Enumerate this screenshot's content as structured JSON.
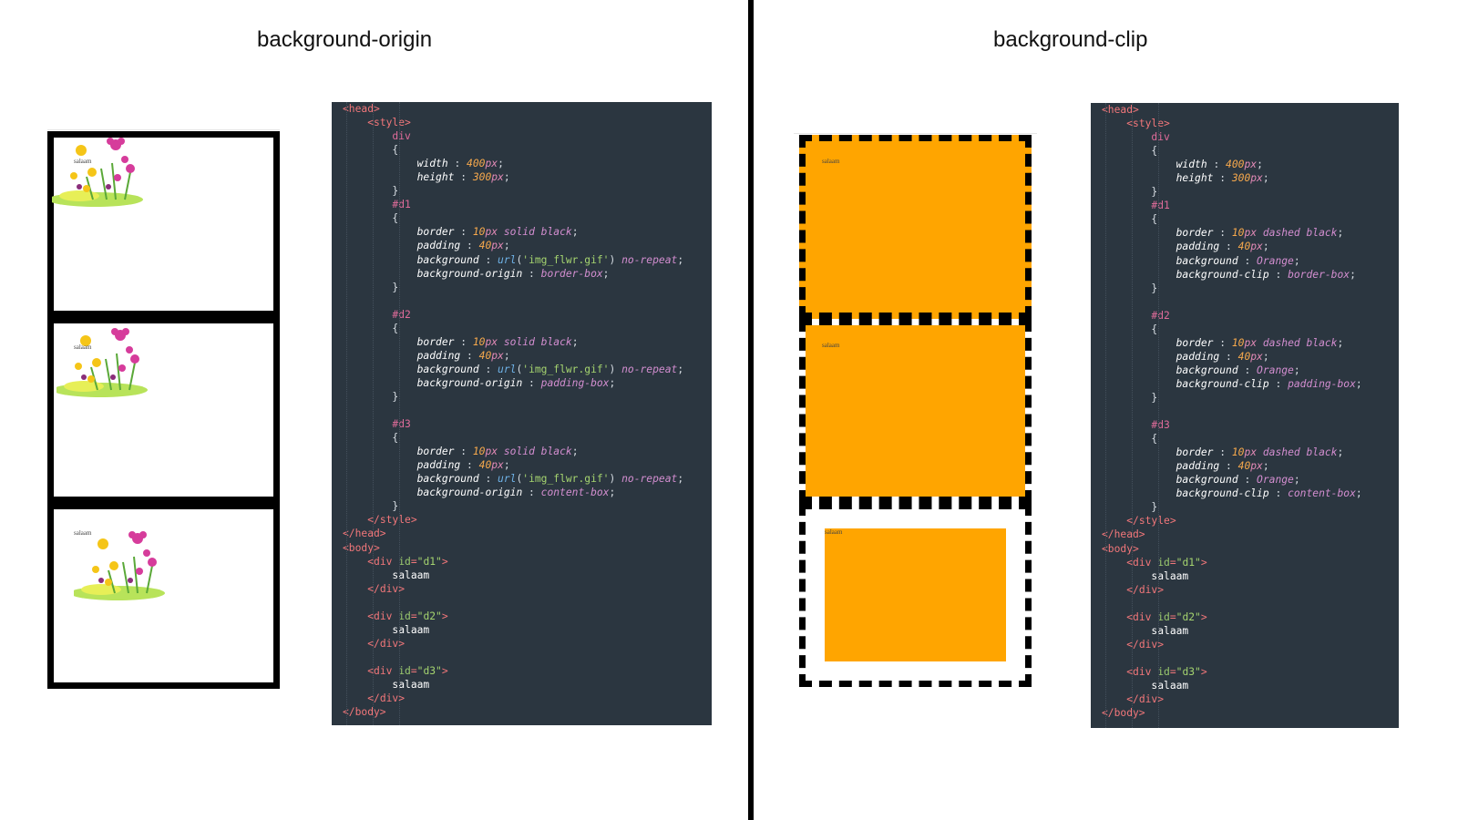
{
  "left_title": "background-origin",
  "right_title": "background-clip",
  "demo_text": "salaam",
  "origin_demo": {
    "boxes": [
      {
        "id": "d1",
        "background_origin": "border-box"
      },
      {
        "id": "d2",
        "background_origin": "padding-box"
      },
      {
        "id": "d3",
        "background_origin": "content-box"
      }
    ]
  },
  "clip_demo": {
    "fill_color": "#ffa500",
    "boxes": [
      {
        "id": "d1",
        "background_clip": "border-box"
      },
      {
        "id": "d2",
        "background_clip": "padding-box"
      },
      {
        "id": "d3",
        "background_clip": "content-box"
      }
    ]
  },
  "origin_code": [
    [
      [
        "tk-tag",
        "<head>"
      ]
    ],
    [
      [
        "tk-p",
        "    "
      ],
      [
        "tk-tag",
        "<style>"
      ]
    ],
    [
      [
        "tk-p",
        "        "
      ],
      [
        "tk-sel",
        "div"
      ]
    ],
    [
      [
        "tk-p",
        "        {"
      ]
    ],
    [
      [
        "tk-p",
        "            "
      ],
      [
        "tk-prop",
        "width"
      ],
      [
        "tk-p",
        " : "
      ],
      [
        "tk-num",
        "400"
      ],
      [
        "tk-unit",
        "px"
      ],
      [
        "tk-p",
        ";"
      ]
    ],
    [
      [
        "tk-p",
        "            "
      ],
      [
        "tk-prop",
        "height"
      ],
      [
        "tk-p",
        " : "
      ],
      [
        "tk-num",
        "300"
      ],
      [
        "tk-unit",
        "px"
      ],
      [
        "tk-p",
        ";"
      ]
    ],
    [
      [
        "tk-p",
        "        }"
      ]
    ],
    [
      [
        "tk-p",
        "        "
      ],
      [
        "tk-sel",
        "#d1"
      ]
    ],
    [
      [
        "tk-p",
        "        {"
      ]
    ],
    [
      [
        "tk-p",
        "            "
      ],
      [
        "tk-prop",
        "border"
      ],
      [
        "tk-p",
        " : "
      ],
      [
        "tk-num",
        "10"
      ],
      [
        "tk-unit",
        "px"
      ],
      [
        "tk-val",
        " solid black"
      ],
      [
        "tk-p",
        ";"
      ]
    ],
    [
      [
        "tk-p",
        "            "
      ],
      [
        "tk-prop",
        "padding"
      ],
      [
        "tk-p",
        " : "
      ],
      [
        "tk-num",
        "40"
      ],
      [
        "tk-unit",
        "px"
      ],
      [
        "tk-p",
        ";"
      ]
    ],
    [
      [
        "tk-p",
        "            "
      ],
      [
        "tk-prop",
        "background"
      ],
      [
        "tk-p",
        " : "
      ],
      [
        "tk-fn",
        "url"
      ],
      [
        "tk-p",
        "("
      ],
      [
        "tk-str",
        "'img_flwr.gif'"
      ],
      [
        "tk-p",
        ") "
      ],
      [
        "tk-val",
        "no-repeat"
      ],
      [
        "tk-p",
        ";"
      ]
    ],
    [
      [
        "tk-p",
        "            "
      ],
      [
        "tk-prop",
        "background-origin"
      ],
      [
        "tk-p",
        " : "
      ],
      [
        "tk-val",
        "border-box"
      ],
      [
        "tk-p",
        ";"
      ]
    ],
    [
      [
        "tk-p",
        "        }"
      ]
    ],
    [
      [
        "tk-p",
        ""
      ]
    ],
    [
      [
        "tk-p",
        "        "
      ],
      [
        "tk-sel",
        "#d2"
      ]
    ],
    [
      [
        "tk-p",
        "        {"
      ]
    ],
    [
      [
        "tk-p",
        "            "
      ],
      [
        "tk-prop",
        "border"
      ],
      [
        "tk-p",
        " : "
      ],
      [
        "tk-num",
        "10"
      ],
      [
        "tk-unit",
        "px"
      ],
      [
        "tk-val",
        " solid black"
      ],
      [
        "tk-p",
        ";"
      ]
    ],
    [
      [
        "tk-p",
        "            "
      ],
      [
        "tk-prop",
        "padding"
      ],
      [
        "tk-p",
        " : "
      ],
      [
        "tk-num",
        "40"
      ],
      [
        "tk-unit",
        "px"
      ],
      [
        "tk-p",
        ";"
      ]
    ],
    [
      [
        "tk-p",
        "            "
      ],
      [
        "tk-prop",
        "background"
      ],
      [
        "tk-p",
        " : "
      ],
      [
        "tk-fn",
        "url"
      ],
      [
        "tk-p",
        "("
      ],
      [
        "tk-str",
        "'img_flwr.gif'"
      ],
      [
        "tk-p",
        ") "
      ],
      [
        "tk-val",
        "no-repeat"
      ],
      [
        "tk-p",
        ";"
      ]
    ],
    [
      [
        "tk-p",
        "            "
      ],
      [
        "tk-prop",
        "background-origin"
      ],
      [
        "tk-p",
        " : "
      ],
      [
        "tk-val",
        "padding-box"
      ],
      [
        "tk-p",
        ";"
      ]
    ],
    [
      [
        "tk-p",
        "        }"
      ]
    ],
    [
      [
        "tk-p",
        ""
      ]
    ],
    [
      [
        "tk-p",
        "        "
      ],
      [
        "tk-sel",
        "#d3"
      ]
    ],
    [
      [
        "tk-p",
        "        {"
      ]
    ],
    [
      [
        "tk-p",
        "            "
      ],
      [
        "tk-prop",
        "border"
      ],
      [
        "tk-p",
        " : "
      ],
      [
        "tk-num",
        "10"
      ],
      [
        "tk-unit",
        "px"
      ],
      [
        "tk-val",
        " solid black"
      ],
      [
        "tk-p",
        ";"
      ]
    ],
    [
      [
        "tk-p",
        "            "
      ],
      [
        "tk-prop",
        "padding"
      ],
      [
        "tk-p",
        " : "
      ],
      [
        "tk-num",
        "40"
      ],
      [
        "tk-unit",
        "px"
      ],
      [
        "tk-p",
        ";"
      ]
    ],
    [
      [
        "tk-p",
        "            "
      ],
      [
        "tk-prop",
        "background"
      ],
      [
        "tk-p",
        " : "
      ],
      [
        "tk-fn",
        "url"
      ],
      [
        "tk-p",
        "("
      ],
      [
        "tk-str",
        "'img_flwr.gif'"
      ],
      [
        "tk-p",
        ") "
      ],
      [
        "tk-val",
        "no-repeat"
      ],
      [
        "tk-p",
        ";"
      ]
    ],
    [
      [
        "tk-p",
        "            "
      ],
      [
        "tk-prop",
        "background-origin"
      ],
      [
        "tk-p",
        " : "
      ],
      [
        "tk-val",
        "content-box"
      ],
      [
        "tk-p",
        ";"
      ]
    ],
    [
      [
        "tk-p",
        "        }"
      ]
    ],
    [
      [
        "tk-p",
        "    "
      ],
      [
        "tk-tag",
        "</style>"
      ]
    ],
    [
      [
        "tk-tag",
        "</head>"
      ]
    ],
    [
      [
        "tk-tag",
        "<body>"
      ]
    ],
    [
      [
        "tk-p",
        "    "
      ],
      [
        "tk-tag",
        "<div "
      ],
      [
        "tk-attr",
        "id"
      ],
      [
        "tk-tag",
        "="
      ],
      [
        "tk-str",
        "\"d1\""
      ],
      [
        "tk-tag",
        ">"
      ]
    ],
    [
      [
        "tk-txt",
        "        salaam"
      ]
    ],
    [
      [
        "tk-p",
        "    "
      ],
      [
        "tk-tag",
        "</div>"
      ]
    ],
    [
      [
        "tk-p",
        ""
      ]
    ],
    [
      [
        "tk-p",
        "    "
      ],
      [
        "tk-tag",
        "<div "
      ],
      [
        "tk-attr",
        "id"
      ],
      [
        "tk-tag",
        "="
      ],
      [
        "tk-str",
        "\"d2\""
      ],
      [
        "tk-tag",
        ">"
      ]
    ],
    [
      [
        "tk-txt",
        "        salaam"
      ]
    ],
    [
      [
        "tk-p",
        "    "
      ],
      [
        "tk-tag",
        "</div>"
      ]
    ],
    [
      [
        "tk-p",
        ""
      ]
    ],
    [
      [
        "tk-p",
        "    "
      ],
      [
        "tk-tag",
        "<div "
      ],
      [
        "tk-attr",
        "id"
      ],
      [
        "tk-tag",
        "="
      ],
      [
        "tk-str",
        "\"d3\""
      ],
      [
        "tk-tag",
        ">"
      ]
    ],
    [
      [
        "tk-txt",
        "        salaam"
      ]
    ],
    [
      [
        "tk-p",
        "    "
      ],
      [
        "tk-tag",
        "</div>"
      ]
    ],
    [
      [
        "tk-tag",
        "</body>"
      ]
    ]
  ],
  "clip_code": [
    [
      [
        "tk-tag",
        "<head>"
      ]
    ],
    [
      [
        "tk-p",
        "    "
      ],
      [
        "tk-tag",
        "<style>"
      ]
    ],
    [
      [
        "tk-p",
        "        "
      ],
      [
        "tk-sel",
        "div"
      ]
    ],
    [
      [
        "tk-p",
        "        {"
      ]
    ],
    [
      [
        "tk-p",
        "            "
      ],
      [
        "tk-prop",
        "width"
      ],
      [
        "tk-p",
        " : "
      ],
      [
        "tk-num",
        "400"
      ],
      [
        "tk-unit",
        "px"
      ],
      [
        "tk-p",
        ";"
      ]
    ],
    [
      [
        "tk-p",
        "            "
      ],
      [
        "tk-prop",
        "height"
      ],
      [
        "tk-p",
        " : "
      ],
      [
        "tk-num",
        "300"
      ],
      [
        "tk-unit",
        "px"
      ],
      [
        "tk-p",
        ";"
      ]
    ],
    [
      [
        "tk-p",
        "        }"
      ]
    ],
    [
      [
        "tk-p",
        "        "
      ],
      [
        "tk-sel",
        "#d1"
      ]
    ],
    [
      [
        "tk-p",
        "        {"
      ]
    ],
    [
      [
        "tk-p",
        "            "
      ],
      [
        "tk-prop",
        "border"
      ],
      [
        "tk-p",
        " : "
      ],
      [
        "tk-num",
        "10"
      ],
      [
        "tk-unit",
        "px"
      ],
      [
        "tk-val",
        " dashed black"
      ],
      [
        "tk-p",
        ";"
      ]
    ],
    [
      [
        "tk-p",
        "            "
      ],
      [
        "tk-prop",
        "padding"
      ],
      [
        "tk-p",
        " : "
      ],
      [
        "tk-num",
        "40"
      ],
      [
        "tk-unit",
        "px"
      ],
      [
        "tk-p",
        ";"
      ]
    ],
    [
      [
        "tk-p",
        "            "
      ],
      [
        "tk-prop",
        "background"
      ],
      [
        "tk-p",
        " : "
      ],
      [
        "tk-val",
        "Orange"
      ],
      [
        "tk-p",
        ";"
      ]
    ],
    [
      [
        "tk-p",
        "            "
      ],
      [
        "tk-prop",
        "background-clip"
      ],
      [
        "tk-p",
        " : "
      ],
      [
        "tk-val",
        "border-box"
      ],
      [
        "tk-p",
        ";"
      ]
    ],
    [
      [
        "tk-p",
        "        }"
      ]
    ],
    [
      [
        "tk-p",
        ""
      ]
    ],
    [
      [
        "tk-p",
        "        "
      ],
      [
        "tk-sel",
        "#d2"
      ]
    ],
    [
      [
        "tk-p",
        "        {"
      ]
    ],
    [
      [
        "tk-p",
        "            "
      ],
      [
        "tk-prop",
        "border"
      ],
      [
        "tk-p",
        " : "
      ],
      [
        "tk-num",
        "10"
      ],
      [
        "tk-unit",
        "px"
      ],
      [
        "tk-val",
        " dashed black"
      ],
      [
        "tk-p",
        ";"
      ]
    ],
    [
      [
        "tk-p",
        "            "
      ],
      [
        "tk-prop",
        "padding"
      ],
      [
        "tk-p",
        " : "
      ],
      [
        "tk-num",
        "40"
      ],
      [
        "tk-unit",
        "px"
      ],
      [
        "tk-p",
        ";"
      ]
    ],
    [
      [
        "tk-p",
        "            "
      ],
      [
        "tk-prop",
        "background"
      ],
      [
        "tk-p",
        " : "
      ],
      [
        "tk-val",
        "Orange"
      ],
      [
        "tk-p",
        ";"
      ]
    ],
    [
      [
        "tk-p",
        "            "
      ],
      [
        "tk-prop",
        "background-clip"
      ],
      [
        "tk-p",
        " : "
      ],
      [
        "tk-val",
        "padding-box"
      ],
      [
        "tk-p",
        ";"
      ]
    ],
    [
      [
        "tk-p",
        "        }"
      ]
    ],
    [
      [
        "tk-p",
        ""
      ]
    ],
    [
      [
        "tk-p",
        "        "
      ],
      [
        "tk-sel",
        "#d3"
      ]
    ],
    [
      [
        "tk-p",
        "        {"
      ]
    ],
    [
      [
        "tk-p",
        "            "
      ],
      [
        "tk-prop",
        "border"
      ],
      [
        "tk-p",
        " : "
      ],
      [
        "tk-num",
        "10"
      ],
      [
        "tk-unit",
        "px"
      ],
      [
        "tk-val",
        " dashed black"
      ],
      [
        "tk-p",
        ";"
      ]
    ],
    [
      [
        "tk-p",
        "            "
      ],
      [
        "tk-prop",
        "padding"
      ],
      [
        "tk-p",
        " : "
      ],
      [
        "tk-num",
        "40"
      ],
      [
        "tk-unit",
        "px"
      ],
      [
        "tk-p",
        ";"
      ]
    ],
    [
      [
        "tk-p",
        "            "
      ],
      [
        "tk-prop",
        "background"
      ],
      [
        "tk-p",
        " : "
      ],
      [
        "tk-val",
        "Orange"
      ],
      [
        "tk-p",
        ";"
      ]
    ],
    [
      [
        "tk-p",
        "            "
      ],
      [
        "tk-prop",
        "background-clip"
      ],
      [
        "tk-p",
        " : "
      ],
      [
        "tk-val",
        "content-box"
      ],
      [
        "tk-p",
        ";"
      ]
    ],
    [
      [
        "tk-p",
        "        }"
      ]
    ],
    [
      [
        "tk-p",
        "    "
      ],
      [
        "tk-tag",
        "</style>"
      ]
    ],
    [
      [
        "tk-tag",
        "</head>"
      ]
    ],
    [
      [
        "tk-tag",
        "<body>"
      ]
    ],
    [
      [
        "tk-p",
        "    "
      ],
      [
        "tk-tag",
        "<div "
      ],
      [
        "tk-attr",
        "id"
      ],
      [
        "tk-tag",
        "="
      ],
      [
        "tk-str",
        "\"d1\""
      ],
      [
        "tk-tag",
        ">"
      ]
    ],
    [
      [
        "tk-txt",
        "        salaam"
      ]
    ],
    [
      [
        "tk-p",
        "    "
      ],
      [
        "tk-tag",
        "</div>"
      ]
    ],
    [
      [
        "tk-p",
        ""
      ]
    ],
    [
      [
        "tk-p",
        "    "
      ],
      [
        "tk-tag",
        "<div "
      ],
      [
        "tk-attr",
        "id"
      ],
      [
        "tk-tag",
        "="
      ],
      [
        "tk-str",
        "\"d2\""
      ],
      [
        "tk-tag",
        ">"
      ]
    ],
    [
      [
        "tk-txt",
        "        salaam"
      ]
    ],
    [
      [
        "tk-p",
        "    "
      ],
      [
        "tk-tag",
        "</div>"
      ]
    ],
    [
      [
        "tk-p",
        ""
      ]
    ],
    [
      [
        "tk-p",
        "    "
      ],
      [
        "tk-tag",
        "<div "
      ],
      [
        "tk-attr",
        "id"
      ],
      [
        "tk-tag",
        "="
      ],
      [
        "tk-str",
        "\"d3\""
      ],
      [
        "tk-tag",
        ">"
      ]
    ],
    [
      [
        "tk-txt",
        "        salaam"
      ]
    ],
    [
      [
        "tk-p",
        "    "
      ],
      [
        "tk-tag",
        "</div>"
      ]
    ],
    [
      [
        "tk-tag",
        "</body>"
      ]
    ]
  ]
}
